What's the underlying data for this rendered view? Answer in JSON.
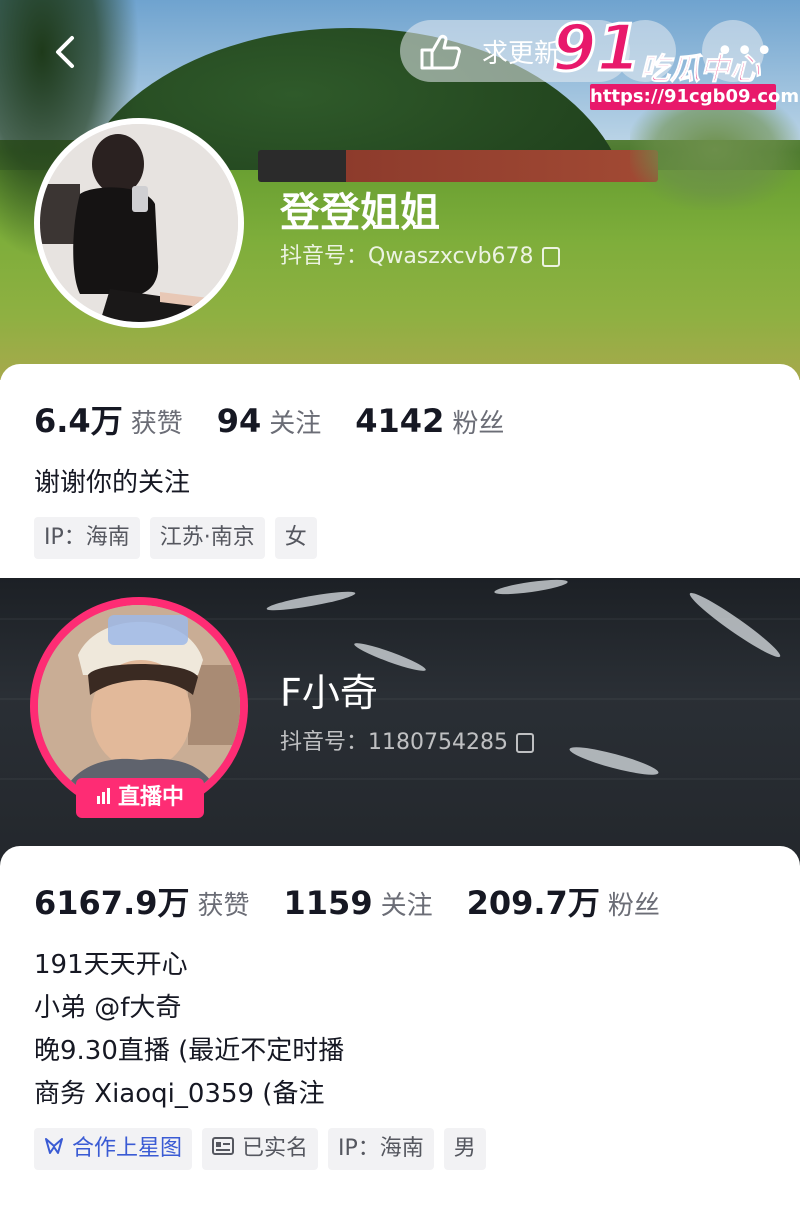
{
  "watermark": {
    "brand_number": "91",
    "brand_name": "吃瓜中心",
    "url": "https://91cgb09.com"
  },
  "top_bar": {
    "follow_request_label": "求更新",
    "more_label": "•••"
  },
  "profile1": {
    "name": "登登姐姐",
    "id_label": "抖音号：",
    "id_value": "Qwaszxcvb678",
    "stats": [
      {
        "value": "6.4万",
        "label": "获赞"
      },
      {
        "value": "94",
        "label": "关注"
      },
      {
        "value": "4142",
        "label": "粉丝"
      }
    ],
    "bio": [
      "谢谢你的关注"
    ],
    "tags": [
      "IP：海南",
      "江苏·南京",
      "女"
    ]
  },
  "profile2": {
    "name": "F小奇",
    "id_label": "抖音号：",
    "id_value": "1180754285",
    "live_label": "直播中",
    "stats": [
      {
        "value": "6167.9万",
        "label": "获赞"
      },
      {
        "value": "1159",
        "label": "关注"
      },
      {
        "value": "209.7万",
        "label": "粉丝"
      }
    ],
    "bio": [
      "191天天开心",
      "小弟 @f大奇",
      "晚9.30直播 (最近不定时播",
      "商务 Xiaoqi_0359 (备注"
    ],
    "tags": [
      "合作上星图",
      "已实名",
      "IP：海南",
      "男"
    ]
  }
}
